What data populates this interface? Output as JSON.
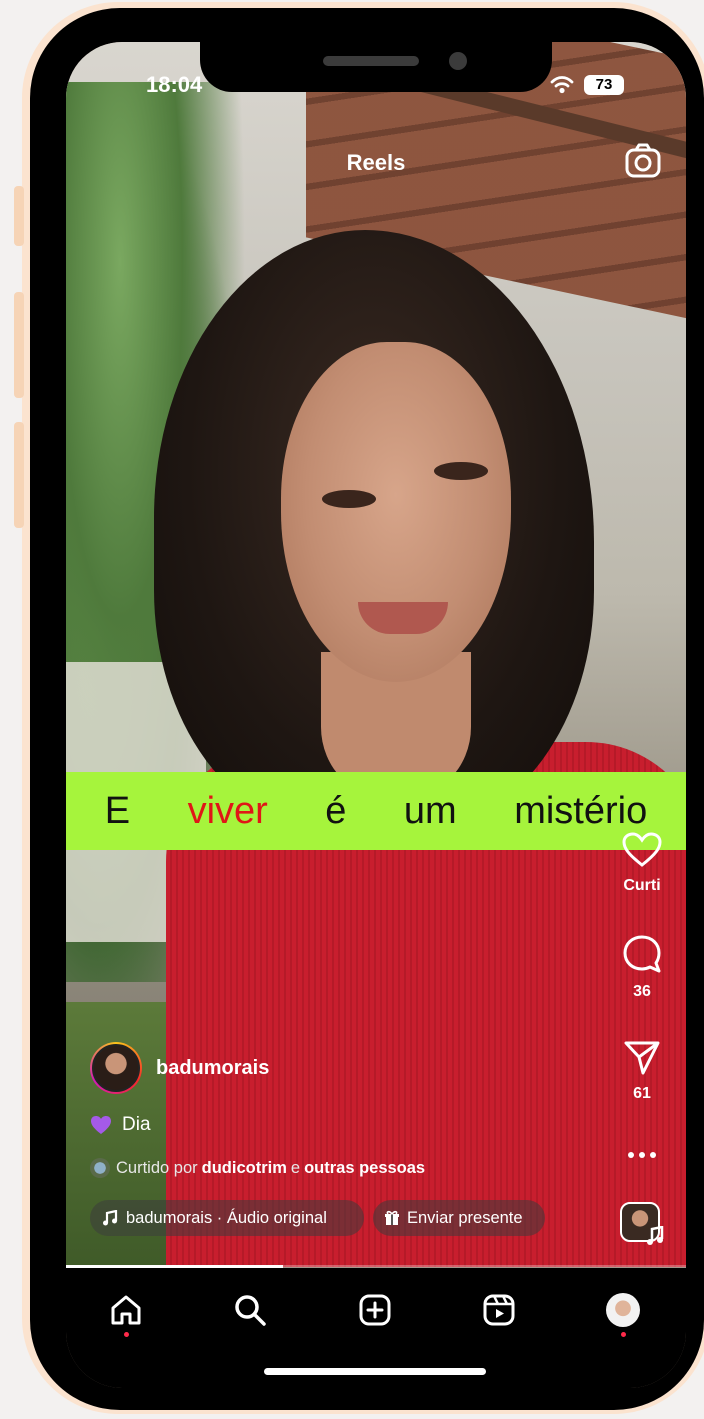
{
  "status_bar": {
    "time": "18:04",
    "battery": "73"
  },
  "header": {
    "title": "Reels",
    "camera_icon": "camera-icon"
  },
  "subtitle": {
    "words": [
      "E",
      "viver",
      "é",
      "um",
      "mistério"
    ],
    "highlight_word": "viver",
    "bg_color": "#a6f43c",
    "highlight_color": "#e01717"
  },
  "actions": {
    "like_label": "Curti",
    "comments_count": "36",
    "shares_count": "61",
    "more_icon": "more-icon"
  },
  "post": {
    "author": "badumorais",
    "caption": "Dia",
    "liked_prefix": "Curtido por",
    "liked_user": "dudicotrim",
    "liked_suffix": "e",
    "liked_others": "outras pessoas",
    "audio": "badumorais · Áudio original",
    "gift": "Enviar presente",
    "progress": 0.35
  },
  "bottom_nav": [
    "home-icon",
    "search-icon",
    "create-icon",
    "reels-icon",
    "profile-avatar"
  ]
}
